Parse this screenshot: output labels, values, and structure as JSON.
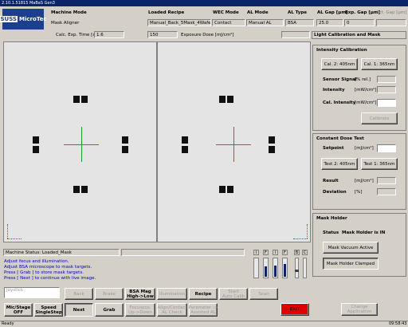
{
  "window": {
    "title": "2.10.1.51815 MaBaS Gen3"
  },
  "logo": {
    "box": "SUSS",
    "text": "MicroTec"
  },
  "header": {
    "machine_mode_label": "Machine Mode",
    "machine_mode_value": "Mask Aligner",
    "loaded_recipe_label": "Loaded Recipe",
    "loaded_recipe_value": "Manual_Back_5Mask_4Wafe",
    "wec_mode_label": "WEC Mode",
    "wec_mode_value": "Contact",
    "al_mode_label": "AL Mode",
    "al_mode_value": "Manual AL",
    "al_type_label": "AL Type",
    "al_type_value": "BSA",
    "al_gap_label": "AL Gap [µm]",
    "al_gap_value": "25.0",
    "exp_gap_label": "Exp. Gap [µm]",
    "exp_gap_value": "0",
    "act_gap_label": "Act. Gap [µm]",
    "calc_exp_time_label": "Calc. Exp. Time [s]",
    "calc_exp_time_value": "1.6",
    "exposure_dose_value": "150",
    "exposure_dose_label": "Exposure Dose [mJ/cm²]",
    "section_title": "Light Calibration and Mask"
  },
  "intensity": {
    "title": "Intensity Calibration",
    "cal2_button": "Cal. 2: 405nm",
    "cal1_button": "Cal. 1: 365nm",
    "sensor_signal_label": "Sensor Signal",
    "sensor_signal_unit": "[% rel.]",
    "intensity_label": "Intensity",
    "intensity_unit": "[mW/cm²]",
    "cal_intensity_label": "Cal. Intensity",
    "cal_intensity_unit": "[mW/cm²]",
    "calibrate_button": "Calibrate"
  },
  "dose_test": {
    "title": "Constant Dose Test",
    "setpoint_label": "Setpoint",
    "setpoint_unit": "[mJ/cm²]",
    "test2_button": "Test 2: 405nm",
    "test1_button": "Test 1: 365nm",
    "result_label": "Result",
    "result_unit": "[mJ/cm²]",
    "deviation_label": "Deviation",
    "deviation_unit": "[%]"
  },
  "mask_holder": {
    "title": "Mask Holder",
    "status_label": "Status",
    "status_value": "Mask Holder is IN",
    "vacuum_button": "Mask Vacuum Active",
    "clamped_button": "Mask Holder Clamped"
  },
  "machine_status": {
    "label": "Machine Status: Loaded_Mask"
  },
  "instructions": [
    "Adjust focus and illumination.",
    "Adjust BSA microscope to mask targets.",
    "Press [ Grab ] to store mask targets.",
    "Press [ Next ] to continue with live image."
  ],
  "meters": [
    {
      "label": "I",
      "level": 0
    },
    {
      "label": "F",
      "level": 0.55
    },
    {
      "label": "I",
      "level": 0.6
    },
    {
      "label": "F",
      "level": 0.65
    }
  ],
  "bc": [
    {
      "label": "B"
    },
    {
      "label": "C"
    }
  ],
  "joystick": {
    "placeholder": "Joystick"
  },
  "toolbar": {
    "mic_stage": "Mic/Stage\nOFF",
    "speed": "Speed\nSingleStep",
    "next": "Next",
    "back": "Back",
    "grab": "Grab",
    "brake": "Brake",
    "bsa_mag": "BSA Mag\nHigh->Low",
    "focus_pos": "Focuspos.\nUp->Down",
    "illumination": "Illumination",
    "align_contact": "Align/Contact\nAL Check",
    "recipe": "Recipe",
    "parameter": "Parameter ->\nAssisted AL",
    "start_auto_calib": "Start\nAuto Calib",
    "scan": "Scan",
    "exit": "EXIT",
    "change_application": "Change\nApplication"
  },
  "statusbar": {
    "ready": "Ready",
    "time": "09:58:43"
  },
  "colors": {
    "exit": "#e00000",
    "crosshair": "#1a9e2a",
    "corner": "#2a8a2a"
  }
}
